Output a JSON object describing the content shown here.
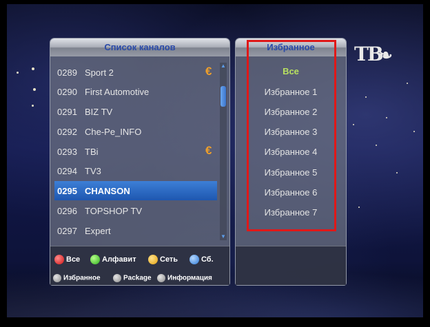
{
  "channel_list": {
    "title": "Список каналов",
    "channels": [
      {
        "number": "0289",
        "name": "Sport 2",
        "icon": "euro-icon",
        "glyph": "€",
        "selected": false
      },
      {
        "number": "0290",
        "name": "First Automotive",
        "icon": "",
        "glyph": "",
        "selected": false
      },
      {
        "number": "0291",
        "name": "BIZ TV",
        "icon": "",
        "glyph": "",
        "selected": false
      },
      {
        "number": "0292",
        "name": "Che-Pe_INFO",
        "icon": "",
        "glyph": "",
        "selected": false
      },
      {
        "number": "0293",
        "name": "TBi",
        "icon": "euro-icon",
        "glyph": "€",
        "selected": false
      },
      {
        "number": "0294",
        "name": "TV3",
        "icon": "",
        "glyph": "",
        "selected": false
      },
      {
        "number": "0295",
        "name": "CHANSON",
        "icon": "",
        "glyph": "",
        "selected": true
      },
      {
        "number": "0296",
        "name": "TOPSHOP TV",
        "icon": "",
        "glyph": "",
        "selected": false
      },
      {
        "number": "0297",
        "name": "Expert",
        "icon": "",
        "glyph": "",
        "selected": false
      }
    ]
  },
  "legend": {
    "all": "Все",
    "alphabet": "Алфавит",
    "network": "Сеть",
    "sb": "Сб.",
    "favorites": "Избранное",
    "package": "Package",
    "info": "Информация"
  },
  "favorites": {
    "title": "Избранное",
    "items": [
      "Все",
      "Избранное 1",
      "Избранное 2",
      "Избранное 3",
      "Избранное 4",
      "Избранное 5",
      "Избранное 6",
      "Избранное 7"
    ],
    "active_index": 0
  },
  "logo": {
    "text": "ТВ"
  },
  "colors": {
    "selection": "#2a68c4",
    "title_text": "#2a4aa8",
    "active_favorite": "#b8e060",
    "highlight_box": "#e01818"
  }
}
